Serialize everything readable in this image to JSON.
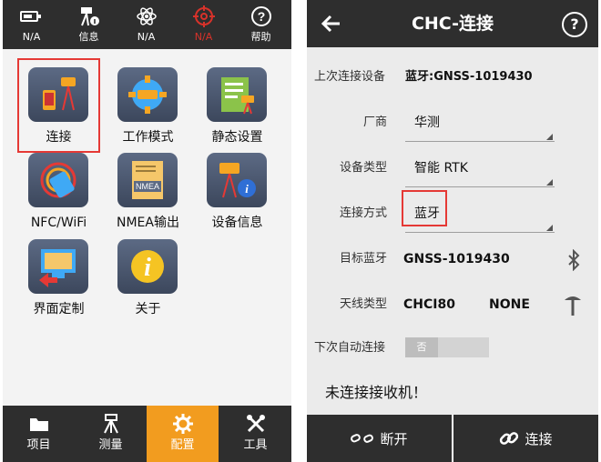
{
  "left": {
    "status_bar": [
      {
        "label": "N/A",
        "icon": "battery-icon"
      },
      {
        "label": "信息",
        "icon": "info-device-icon"
      },
      {
        "label": "N/A",
        "icon": "atom-icon"
      },
      {
        "label": "N/A",
        "icon": "crosshair-icon"
      },
      {
        "label": "帮助",
        "icon": "help-icon"
      }
    ],
    "apps": [
      {
        "label": "连接",
        "icon": "connect-icon"
      },
      {
        "label": "工作模式",
        "icon": "work-mode-icon"
      },
      {
        "label": "静态设置",
        "icon": "static-settings-icon"
      },
      {
        "label": "NFC/WiFi",
        "icon": "nfc-wifi-icon"
      },
      {
        "label": "NMEA输出",
        "icon": "nmea-output-icon",
        "badge": "NMEA"
      },
      {
        "label": "设备信息",
        "icon": "device-info-icon"
      },
      {
        "label": "界面定制",
        "icon": "ui-custom-icon"
      },
      {
        "label": "关于",
        "icon": "about-icon"
      }
    ],
    "tabs": [
      {
        "label": "项目",
        "icon": "project-icon"
      },
      {
        "label": "测量",
        "icon": "survey-icon"
      },
      {
        "label": "配置",
        "icon": "config-icon"
      },
      {
        "label": "工具",
        "icon": "tools-icon"
      }
    ],
    "colors": {
      "bar": "#2e2e2e",
      "active_tab": "#f29c1f",
      "highlight": "#e53935",
      "status_alert": "#d8322a"
    }
  },
  "right": {
    "title": "CHC-连接",
    "help": "?",
    "last_device_label": "上次连接设备",
    "last_device_value": "蓝牙:GNSS-1019430",
    "manufacturer_label": "厂商",
    "manufacturer_value": "华测",
    "device_type_label": "设备类型",
    "device_type_value": "智能 RTK",
    "connect_mode_label": "连接方式",
    "connect_mode_value": "蓝牙",
    "target_bt_label": "目标蓝牙",
    "target_bt_value": "GNSS-1019430",
    "antenna_label": "天线类型",
    "antenna_value": "CHCI80",
    "antenna_value2": "NONE",
    "auto_connect_label": "下次自动连接",
    "auto_connect_state": "否",
    "status_message": "未连接接收机！",
    "disconnect_label": "断开",
    "connect_label": "连接"
  }
}
